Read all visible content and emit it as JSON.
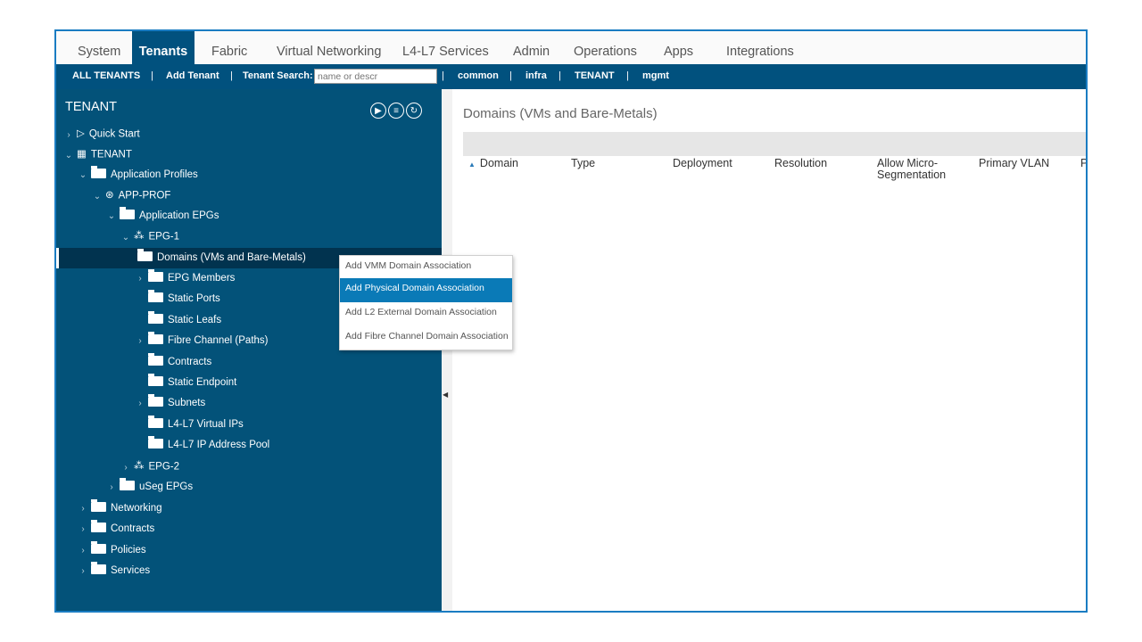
{
  "top_tabs": [
    "System",
    "Tenants",
    "Fabric",
    "Virtual Networking",
    "L4-L7 Services",
    "Admin",
    "Operations",
    "Apps",
    "Integrations"
  ],
  "active_tab": "Tenants",
  "subnav": {
    "all_tenants": "ALL TENANTS",
    "sep": "|",
    "add_tenant": "Add Tenant",
    "tenant_search_label": "Tenant Search:",
    "tenant_search_placeholder": "name or descr",
    "quick_tenants": [
      "common",
      "infra",
      "TENANT",
      "mgmt"
    ]
  },
  "left_panel": {
    "title": "TENANT",
    "header_icons": [
      "quick-start-icon",
      "list-icon",
      "refresh-icon"
    ],
    "tree": [
      {
        "label": "Quick Start",
        "icon": "quick-start-icon"
      },
      {
        "label": "TENANT",
        "icon": "tenant-icon"
      },
      {
        "label": "Application Profiles",
        "icon": "folder-icon"
      },
      {
        "label": "APP-PROF",
        "icon": "app-profile-icon"
      },
      {
        "label": "Application EPGs",
        "icon": "folder-icon"
      },
      {
        "label": "EPG-1",
        "icon": "epg-icon"
      },
      {
        "label": "Domains (VMs and Bare-Metals)",
        "icon": "folder-icon"
      },
      {
        "label": "EPG Members",
        "icon": "folder-icon"
      },
      {
        "label": "Static Ports",
        "icon": "folder-icon"
      },
      {
        "label": "Static Leafs",
        "icon": "folder-icon"
      },
      {
        "label": "Fibre Channel (Paths)",
        "icon": "folder-icon"
      },
      {
        "label": "Contracts",
        "icon": "folder-icon"
      },
      {
        "label": "Static Endpoint",
        "icon": "folder-icon"
      },
      {
        "label": "Subnets",
        "icon": "folder-icon"
      },
      {
        "label": "L4-L7 Virtual IPs",
        "icon": "folder-icon"
      },
      {
        "label": "L4-L7 IP Address Pool",
        "icon": "folder-icon"
      },
      {
        "label": "EPG-2",
        "icon": "epg-icon"
      },
      {
        "label": "uSeg EPGs",
        "icon": "folder-icon"
      },
      {
        "label": "Networking",
        "icon": "folder-icon"
      },
      {
        "label": "Contracts",
        "icon": "folder-icon"
      },
      {
        "label": "Policies",
        "icon": "folder-icon"
      },
      {
        "label": "Services",
        "icon": "folder-icon"
      }
    ]
  },
  "main": {
    "title": "Domains (VMs and Bare-Metals)",
    "columns": [
      "Domain",
      "Type",
      "Deployment",
      "Resolution",
      "Allow Micro-\nSegmentation",
      "Primary VLAN",
      "P"
    ],
    "sort_indicator": "▲"
  },
  "context_menu": {
    "items": [
      "Add VMM Domain Association",
      "Add Physical Domain Association",
      "Add L2 External Domain Association",
      "Add Fibre Channel Domain Association"
    ],
    "highlighted": "Add Physical Domain Association"
  },
  "colors": {
    "nav_blue": "#01517e",
    "tree_bg": "#035279",
    "selection": "#01334f",
    "menu_highlight": "#0a7ab7",
    "frame_border": "#1a7cc2"
  }
}
